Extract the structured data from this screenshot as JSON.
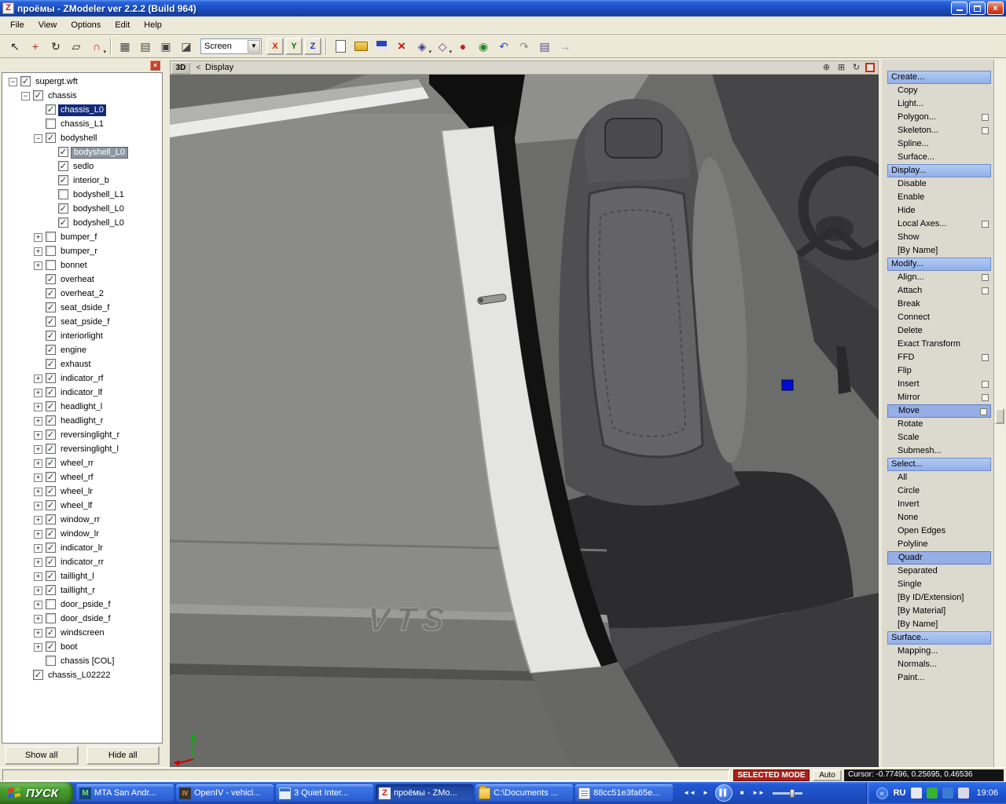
{
  "window": {
    "title": "проёмы - ZModeler ver 2.2.2 (Build 964)"
  },
  "menubar": [
    "File",
    "View",
    "Options",
    "Edit",
    "Help"
  ],
  "toolbar": {
    "combo_value": "Screen",
    "axis_buttons": [
      {
        "label": "X",
        "color": "#cc2200"
      },
      {
        "label": "Y",
        "color": "#0a7a0a"
      },
      {
        "label": "Z",
        "color": "#1133cc"
      }
    ],
    "group_select": [
      {
        "name": "select-arrow-icon",
        "glyph": "↖",
        "color": "#1a1a1a"
      },
      {
        "name": "move-tool-icon",
        "glyph": "+",
        "color": "#b02020"
      },
      {
        "name": "rotate-tool-icon",
        "glyph": "↻",
        "color": "#1a1a1a"
      },
      {
        "name": "scale-tool-icon",
        "glyph": "▱",
        "color": "#1a1a1a"
      },
      {
        "name": "snap-tool-icon",
        "glyph": "∩",
        "color": "#c02020",
        "dropdown": true
      }
    ],
    "group_view": [
      {
        "name": "wireframe-view-icon",
        "glyph": "▦",
        "color": "#444444"
      },
      {
        "name": "shaded-view-icon",
        "glyph": "▤",
        "color": "#444444"
      },
      {
        "name": "textured-view-icon",
        "glyph": "▣",
        "color": "#444444"
      },
      {
        "name": "grid-view-icon",
        "glyph": "◪",
        "color": "#444444"
      }
    ],
    "group_file": [
      {
        "name": "new-file-icon",
        "css": "new"
      },
      {
        "name": "open-file-icon",
        "css": "open"
      },
      {
        "name": "save-file-icon",
        "css": "save"
      },
      {
        "name": "delete-icon",
        "css": "delete"
      }
    ],
    "group_extra": [
      {
        "name": "primitives-dropdown-icon",
        "glyph": "◈",
        "color": "#3a3a8a",
        "dropdown": true
      },
      {
        "name": "modifiers-dropdown-icon",
        "glyph": "◇",
        "color": "#6a3a8a",
        "dropdown": true
      },
      {
        "name": "material-editor-icon",
        "glyph": "●",
        "color": "#c02020"
      },
      {
        "name": "render-icon",
        "glyph": "◉",
        "color": "#1e8a1e"
      },
      {
        "name": "undo-icon",
        "glyph": "↶",
        "color": "#2a50c8"
      },
      {
        "name": "redo-icon",
        "glyph": "↷",
        "color": "#8a8a8a"
      },
      {
        "name": "notes-icon",
        "glyph": "▤",
        "color": "#4a4a8a"
      },
      {
        "name": "history-forward-icon",
        "glyph": "→",
        "color": "#9a9a9a"
      }
    ]
  },
  "sidebar": {
    "show_all": "Show all",
    "hide_all": "Hide all",
    "tree": [
      {
        "label": "supergt.wft",
        "level": 0,
        "expand": "minus",
        "checked": true
      },
      {
        "label": "chassis",
        "level": 1,
        "expand": "minus",
        "checked": true
      },
      {
        "label": "chassis_L0",
        "level": 2,
        "expand": null,
        "checked": true,
        "sel": "primary"
      },
      {
        "label": "chassis_L1",
        "level": 2,
        "expand": null,
        "checked": false
      },
      {
        "label": "bodyshell",
        "level": 2,
        "expand": "minus",
        "checked": true
      },
      {
        "label": "bodyshell_L0",
        "level": 3,
        "expand": null,
        "checked": true,
        "sel": "secondary"
      },
      {
        "label": "sedlo",
        "level": 3,
        "expand": null,
        "checked": true
      },
      {
        "label": "interior_b",
        "level": 3,
        "expand": null,
        "checked": true
      },
      {
        "label": "bodyshell_L1",
        "level": 3,
        "expand": null,
        "checked": false
      },
      {
        "label": "bodyshell_L0",
        "level": 3,
        "expand": null,
        "checked": true
      },
      {
        "label": "bodyshell_L0",
        "level": 3,
        "expand": null,
        "checked": true
      },
      {
        "label": "bumper_f",
        "level": 2,
        "expand": "plus",
        "checked": false
      },
      {
        "label": "bumper_r",
        "level": 2,
        "expand": "plus",
        "checked": false
      },
      {
        "label": "bonnet",
        "level": 2,
        "expand": "plus",
        "checked": false
      },
      {
        "label": "overheat",
        "level": 2,
        "expand": null,
        "checked": true
      },
      {
        "label": "overheat_2",
        "level": 2,
        "expand": null,
        "checked": true
      },
      {
        "label": "seat_dside_f",
        "level": 2,
        "expand": null,
        "checked": true
      },
      {
        "label": "seat_pside_f",
        "level": 2,
        "expand": null,
        "checked": true
      },
      {
        "label": "interiorlight",
        "level": 2,
        "expand": null,
        "checked": true
      },
      {
        "label": "engine",
        "level": 2,
        "expand": null,
        "checked": true
      },
      {
        "label": "exhaust",
        "level": 2,
        "expand": null,
        "checked": true
      },
      {
        "label": "indicator_rf",
        "level": 2,
        "expand": "plus",
        "checked": true
      },
      {
        "label": "indicator_lf",
        "level": 2,
        "expand": "plus",
        "checked": true
      },
      {
        "label": "headlight_l",
        "level": 2,
        "expand": "plus",
        "checked": true
      },
      {
        "label": "headlight_r",
        "level": 2,
        "expand": "plus",
        "checked": true
      },
      {
        "label": "reversinglight_r",
        "level": 2,
        "expand": "plus",
        "checked": true
      },
      {
        "label": "reversinglight_l",
        "level": 2,
        "expand": "plus",
        "checked": true
      },
      {
        "label": "wheel_rr",
        "level": 2,
        "expand": "plus",
        "checked": true
      },
      {
        "label": "wheel_rf",
        "level": 2,
        "expand": "plus",
        "checked": true
      },
      {
        "label": "wheel_lr",
        "level": 2,
        "expand": "plus",
        "checked": true
      },
      {
        "label": "wheel_lf",
        "level": 2,
        "expand": "plus",
        "checked": true
      },
      {
        "label": "window_rr",
        "level": 2,
        "expand": "plus",
        "checked": true
      },
      {
        "label": "window_lr",
        "level": 2,
        "expand": "plus",
        "checked": true
      },
      {
        "label": "indicator_lr",
        "level": 2,
        "expand": "plus",
        "checked": true
      },
      {
        "label": "indicator_rr",
        "level": 2,
        "expand": "plus",
        "checked": true
      },
      {
        "label": "taillight_l",
        "level": 2,
        "expand": "plus",
        "checked": true
      },
      {
        "label": "taillight_r",
        "level": 2,
        "expand": "plus",
        "checked": true
      },
      {
        "label": "door_pside_f",
        "level": 2,
        "expand": "plus",
        "checked": false
      },
      {
        "label": "door_dside_f",
        "level": 2,
        "expand": "plus",
        "checked": false
      },
      {
        "label": "windscreen",
        "level": 2,
        "expand": "plus",
        "checked": true
      },
      {
        "label": "boot",
        "level": 2,
        "expand": "plus",
        "checked": true
      },
      {
        "label": "chassis [COL]",
        "level": 2,
        "expand": null,
        "checked": false
      },
      {
        "label": "chassis_L02222",
        "level": 1,
        "expand": null,
        "checked": true
      }
    ]
  },
  "viewport": {
    "tab": "3D",
    "back": "<",
    "header": "Display",
    "watermark": "VTS"
  },
  "command_panel": [
    {
      "label": "Create...",
      "kind": "header"
    },
    {
      "label": "Copy",
      "kind": "item"
    },
    {
      "label": "Light...",
      "kind": "item"
    },
    {
      "label": "Polygon...",
      "kind": "item",
      "checkbox": true
    },
    {
      "label": "Skeleton...",
      "kind": "item",
      "checkbox": true
    },
    {
      "label": "Spline...",
      "kind": "item"
    },
    {
      "label": "Surface...",
      "kind": "item"
    },
    {
      "label": "Display...",
      "kind": "header"
    },
    {
      "label": "Disable",
      "kind": "item"
    },
    {
      "label": "Enable",
      "kind": "item"
    },
    {
      "label": "Hide",
      "kind": "item"
    },
    {
      "label": "Local Axes...",
      "kind": "item",
      "checkbox": true
    },
    {
      "label": "Show",
      "kind": "item"
    },
    {
      "label": "[By Name]",
      "kind": "item"
    },
    {
      "label": "Modify...",
      "kind": "header"
    },
    {
      "label": "Align...",
      "kind": "item",
      "checkbox": true
    },
    {
      "label": "Attach",
      "kind": "item",
      "checkbox": true
    },
    {
      "label": "Break",
      "kind": "item"
    },
    {
      "label": "Connect",
      "kind": "item"
    },
    {
      "label": "Delete",
      "kind": "item"
    },
    {
      "label": "Exact Transform",
      "kind": "item"
    },
    {
      "label": "FFD",
      "kind": "item",
      "checkbox": true
    },
    {
      "label": "Flip",
      "kind": "item"
    },
    {
      "label": "Insert",
      "kind": "item",
      "checkbox": true
    },
    {
      "label": "Mirror",
      "kind": "item",
      "checkbox": true
    },
    {
      "label": "Move",
      "kind": "item",
      "selected": true,
      "checkbox": true
    },
    {
      "label": "Rotate",
      "kind": "item"
    },
    {
      "label": "Scale",
      "kind": "item"
    },
    {
      "label": "Submesh...",
      "kind": "item"
    },
    {
      "label": "Select...",
      "kind": "header"
    },
    {
      "label": "All",
      "kind": "item"
    },
    {
      "label": "Circle",
      "kind": "item"
    },
    {
      "label": "Invert",
      "kind": "item"
    },
    {
      "label": "None",
      "kind": "item"
    },
    {
      "label": "Open Edges",
      "kind": "item"
    },
    {
      "label": "Polyline",
      "kind": "item"
    },
    {
      "label": "Quadr",
      "kind": "item",
      "selected": true
    },
    {
      "label": "Separated",
      "kind": "item"
    },
    {
      "label": "Single",
      "kind": "item"
    },
    {
      "label": "[By ID/Extension]",
      "kind": "item"
    },
    {
      "label": "[By Material]",
      "kind": "item"
    },
    {
      "label": "[By Name]",
      "kind": "item"
    },
    {
      "label": "Surface...",
      "kind": "header"
    },
    {
      "label": "Mapping...",
      "kind": "item"
    },
    {
      "label": "Normals...",
      "kind": "item"
    },
    {
      "label": "Paint...",
      "kind": "item"
    }
  ],
  "statusbar": {
    "selected_mode": "SELECTED MODE",
    "auto": "Auto",
    "cursor": "Cursor: -0.77496, 0.25695, 0.46536"
  },
  "taskbar": {
    "start": "ПУСК",
    "tasks": [
      {
        "label": "MTA San Andr...",
        "icon": "mta",
        "active": false
      },
      {
        "label": "OpenIV - vehicl...",
        "icon": "openiv",
        "active": false
      },
      {
        "label": "3 Quiet Inter...",
        "icon": "group",
        "active": false
      },
      {
        "label": "проёмы - ZMo...",
        "icon": "zm",
        "active": true
      },
      {
        "label": "C:\\Documents ...",
        "icon": "folder",
        "active": false
      },
      {
        "label": "88cc51e3fa65e...",
        "icon": "notepad",
        "active": false
      }
    ],
    "media": [
      {
        "name": "media-prev-button",
        "glyph": "◄◄"
      },
      {
        "name": "media-play-button",
        "glyph": "►"
      },
      {
        "name": "media-pause-button",
        "glyph": "▌▌",
        "primary": true
      },
      {
        "name": "media-stop-button",
        "glyph": "■"
      },
      {
        "name": "media-next-button",
        "glyph": "►►"
      }
    ],
    "tray": {
      "chevron": "«",
      "lang": "RU",
      "icons": [
        {
          "name": "tray-icon-1",
          "color": "#e8e8e8"
        },
        {
          "name": "tray-icon-2",
          "color": "#34b434"
        },
        {
          "name": "tray-icon-3",
          "color": "#3a7bd5"
        },
        {
          "name": "tray-icon-4",
          "color": "#d8d8e8"
        }
      ],
      "time": "19:06"
    }
  }
}
